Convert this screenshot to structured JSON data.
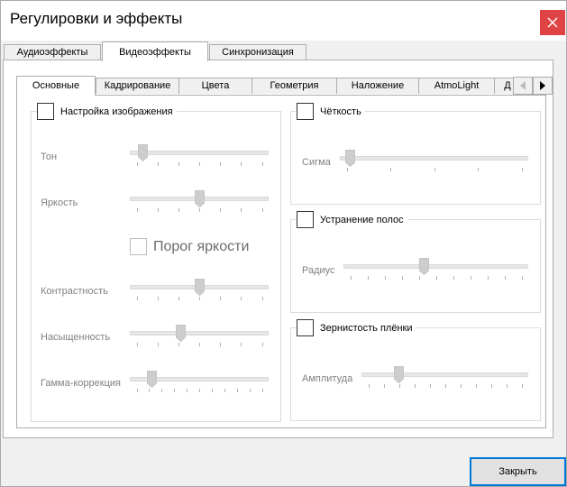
{
  "window": {
    "title": "Регулировки и эффекты"
  },
  "outer_tabs": [
    "Аудиоэффекты",
    "Видеоэффекты",
    "Синхронизация"
  ],
  "outer_active": 1,
  "inner_tabs": [
    "Основные",
    "Кадрирование",
    "Цвета",
    "Геометрия",
    "Наложение",
    "AtmoLight",
    "Д"
  ],
  "inner_active": 0,
  "image_adjust": {
    "title": "Настройка изображения",
    "threshold_label": "Порог яркости",
    "sliders": [
      {
        "label": "Тон",
        "value": 0.05
      },
      {
        "label": "Яркость",
        "value": 0.5
      },
      {
        "label": "Контрастность",
        "value": 0.5
      },
      {
        "label": "Насыщенность",
        "value": 0.35
      },
      {
        "label": "Гамма-коррекция",
        "value": 0.12
      }
    ]
  },
  "sharpness": {
    "title": "Чёткость",
    "slider_label": "Сигма",
    "value": 0.02
  },
  "debanding": {
    "title": "Устранение полос",
    "slider_label": "Радиус",
    "value": 0.43
  },
  "film_grain": {
    "title": "Зернистость плёнки",
    "slider_label": "Амплитуда",
    "value": 0.2
  },
  "footer": {
    "close_label": "Закрыть"
  }
}
